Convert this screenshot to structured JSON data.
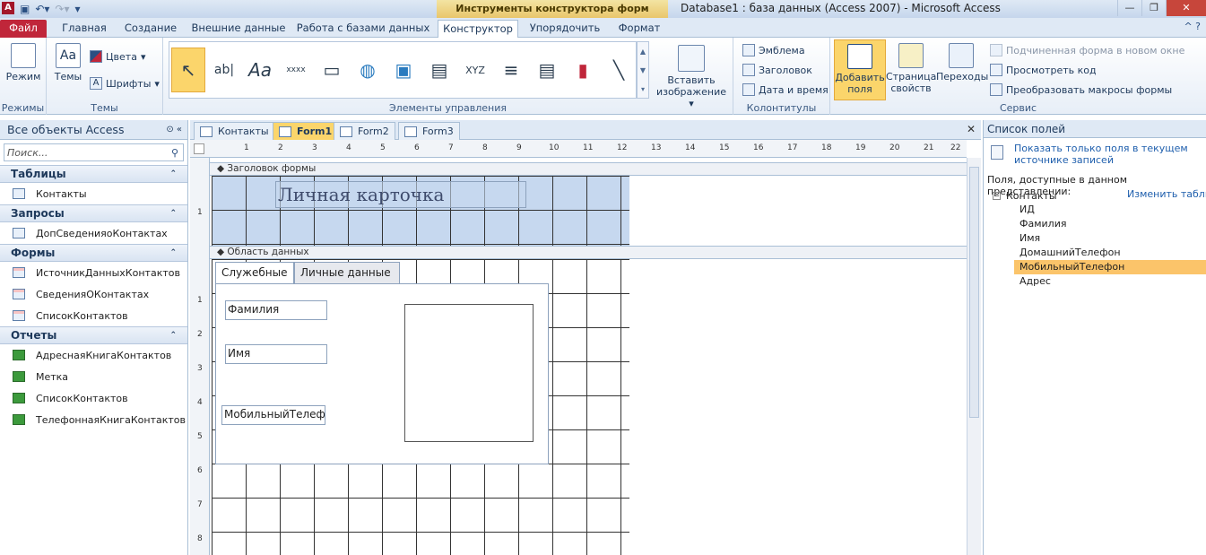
{
  "titlebar": {
    "app_icon": "A",
    "context_header": "Инструменты конструктора форм",
    "window_title": "Database1 : база данных (Access 2007)  -  Microsoft Access",
    "icons": [
      "save-icon",
      "undo-icon",
      "redo-icon",
      "customize-icon"
    ]
  },
  "ribbon_tabs": {
    "file": "Файл",
    "home": "Главная",
    "create": "Создание",
    "external": "Внешние данные",
    "dbtools": "Работа с базами данных",
    "design": "Конструктор",
    "arrange": "Упорядочить",
    "format": "Формат"
  },
  "ribbon": {
    "views": {
      "label": "Режим",
      "group": "Режимы"
    },
    "themes": {
      "themes_label": "Темы",
      "colors": "Цвета",
      "fonts": "Шрифты",
      "group": "Темы"
    },
    "controls": {
      "group": "Элементы управления",
      "insert_image": "Вставить изображение"
    },
    "header_footer": {
      "logo": "Эмблема",
      "title": "Заголовок",
      "datetime": "Дата и время",
      "group": "Колонтитулы"
    },
    "tools": {
      "add_fields": "Добавить поля",
      "property_sheet": "Страница свойств",
      "tab_order": "Переходы",
      "subform_new_window": "Подчиненная форма в новом окне",
      "view_code": "Просмотреть код",
      "convert_macros": "Преобразовать макросы формы",
      "group": "Сервис"
    }
  },
  "navpane": {
    "title": "Все объекты Access",
    "search_placeholder": "Поиск...",
    "groups": [
      {
        "name": "Таблицы",
        "items": [
          "Контакты"
        ]
      },
      {
        "name": "Запросы",
        "items": [
          "ДопСведенияоКонтактах"
        ]
      },
      {
        "name": "Формы",
        "items": [
          "ИсточникДанныхКонтактов",
          "СведенияОКонтактах",
          "СписокКонтактов"
        ]
      },
      {
        "name": "Отчеты",
        "items": [
          "АдреснаяКнигаКонтактов",
          "Метка",
          "СписокКонтактов",
          "ТелефоннаяКнигаКонтактов"
        ]
      }
    ]
  },
  "doc_tabs": [
    "Контакты",
    "Form1",
    "Form2",
    "Form3"
  ],
  "design": {
    "header_section": "Заголовок формы",
    "detail_section": "Область данных",
    "form_title": "Личная карточка",
    "tab_pages": [
      "Служебные",
      "Личные данные"
    ],
    "fields": [
      "Фамилия",
      "Имя",
      "МобильныйТелеф"
    ]
  },
  "fieldlist": {
    "title": "Список полей",
    "show_only_link": "Показать только поля в текущем источнике записей",
    "available_label": "Поля, доступные в данном представлении:",
    "table": "Контакты",
    "edit_table": "Изменить таблицу",
    "fields": [
      "ИД",
      "Фамилия",
      "Имя",
      "ДомашнийТелефон",
      "МобильныйТелефон",
      "Адрес"
    ],
    "selected_field": "МобильныйТелефон"
  }
}
